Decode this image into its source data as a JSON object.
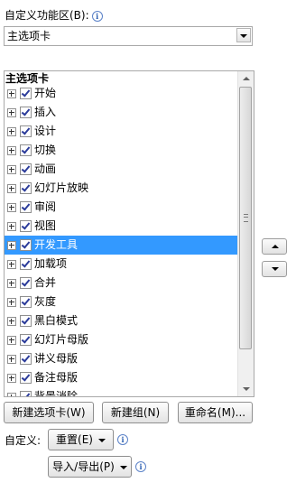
{
  "header": {
    "title": "自定义功能区(B):",
    "info_icon": "i"
  },
  "tab_select": {
    "value": "主选项卡"
  },
  "tree": {
    "header": "主选项卡",
    "items": [
      {
        "label": "开始",
        "checked": true
      },
      {
        "label": "插入",
        "checked": true
      },
      {
        "label": "设计",
        "checked": true
      },
      {
        "label": "切换",
        "checked": true
      },
      {
        "label": "动画",
        "checked": true
      },
      {
        "label": "幻灯片放映",
        "checked": true
      },
      {
        "label": "审阅",
        "checked": true
      },
      {
        "label": "视图",
        "checked": true
      },
      {
        "label": "开发工具",
        "checked": true,
        "selected": true
      },
      {
        "label": "加载项",
        "checked": true
      },
      {
        "label": "合并",
        "checked": true
      },
      {
        "label": "灰度",
        "checked": true
      },
      {
        "label": "黑白模式",
        "checked": true
      },
      {
        "label": "幻灯片母版",
        "checked": true
      },
      {
        "label": "讲义母版",
        "checked": true
      },
      {
        "label": "备注母版",
        "checked": true
      },
      {
        "label": "背景消除",
        "checked": true
      }
    ]
  },
  "buttons": {
    "new_tab": "新建选项卡(W)",
    "new_group": "新建组(N)",
    "rename": "重命名(M)...",
    "reset": "重置(E)",
    "import_export": "导入/导出(P)"
  },
  "custom_label": "自定义:",
  "colors": {
    "selection": "#3399ff",
    "border": "#a9a9a9"
  }
}
